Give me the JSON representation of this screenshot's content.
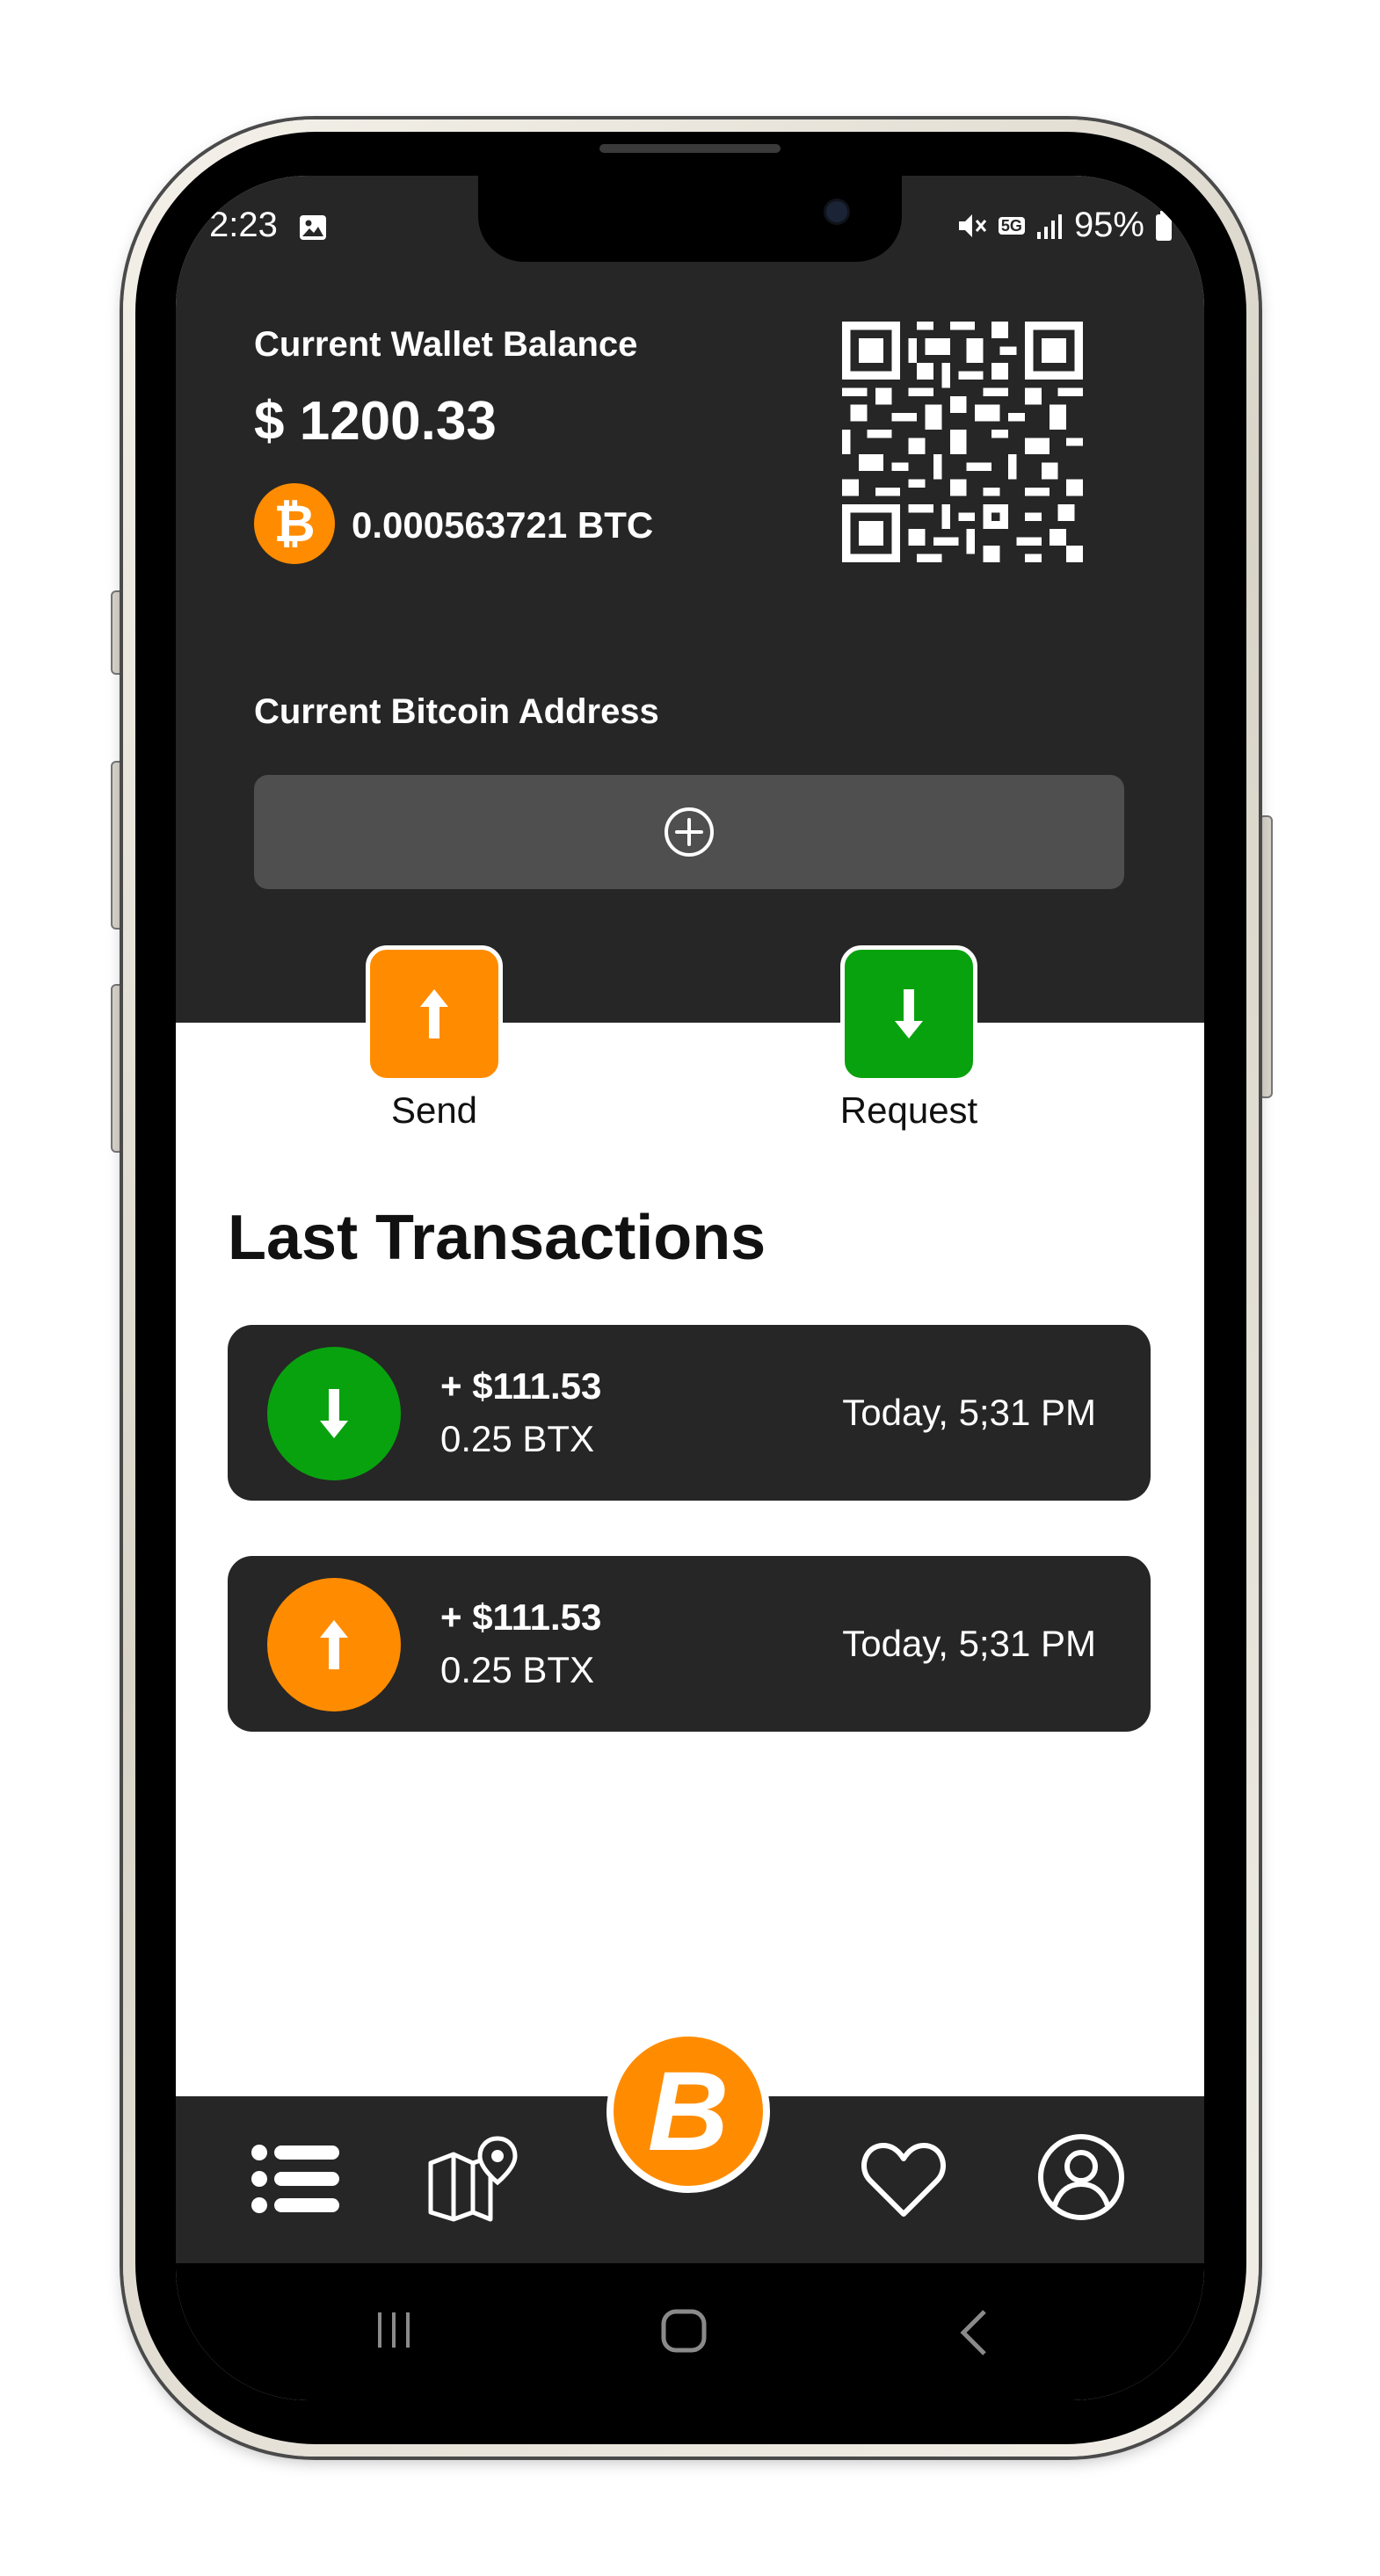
{
  "status_bar": {
    "time": "2:23",
    "network": "5G",
    "battery": "95%"
  },
  "wallet": {
    "balance_label": "Current Wallet Balance",
    "balance_usd": "$ 1200.33",
    "coin_symbol": "₿",
    "balance_btc": "0.000563721 BTC",
    "address_label": "Current Bitcoin Address"
  },
  "actions": {
    "send_label": "Send",
    "request_label": "Request"
  },
  "transactions": {
    "title": "Last Transactions",
    "items": [
      {
        "type": "incoming",
        "amount": "+ $111.53",
        "btc": "0.25 BTX",
        "time": "Today, 5;31 PM"
      },
      {
        "type": "outgoing",
        "amount": "+ $111.53",
        "btc": "0.25 BTX",
        "time": "Today, 5;31 PM"
      }
    ]
  },
  "bottom_nav": {
    "center_symbol": "B",
    "items": [
      "list-icon",
      "map-icon",
      "bitcoin-icon",
      "heart-icon",
      "profile-icon"
    ]
  },
  "colors": {
    "dark_panel": "#262626",
    "accent_orange": "#ff8c00",
    "accent_green": "#09a20f",
    "field_gray": "#4f4f4f"
  }
}
